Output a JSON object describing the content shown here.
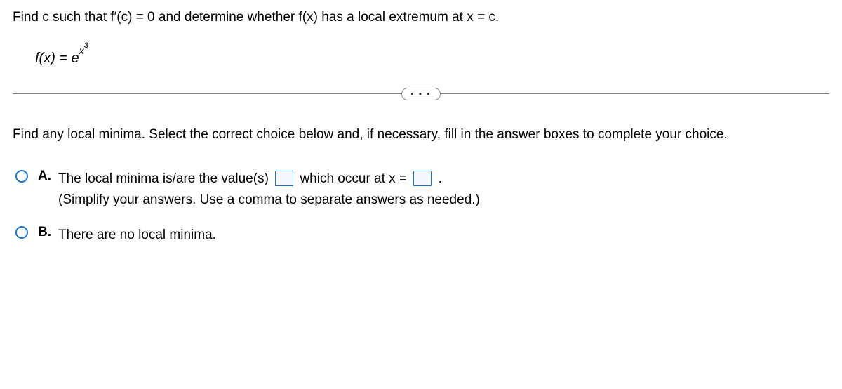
{
  "question": "Find c such that f′(c) = 0 and determine whether f(x) has a local extremum at x = c.",
  "formula": {
    "lhs": "f(x) = ",
    "base": "e",
    "exp_var": "x",
    "exp_pow": "3"
  },
  "divider_dots": "• • •",
  "instruction": "Find any local minima. Select the correct choice below and, if necessary, fill in the answer boxes to complete your choice.",
  "choices": {
    "a": {
      "label": "A.",
      "text_part1": "The local minima is/are the value(s) ",
      "text_part2": " which occur at x = ",
      "text_part3": ".",
      "hint": "(Simplify your answers. Use a comma to separate answers as needed.)"
    },
    "b": {
      "label": "B.",
      "text": "There are no local minima."
    }
  }
}
